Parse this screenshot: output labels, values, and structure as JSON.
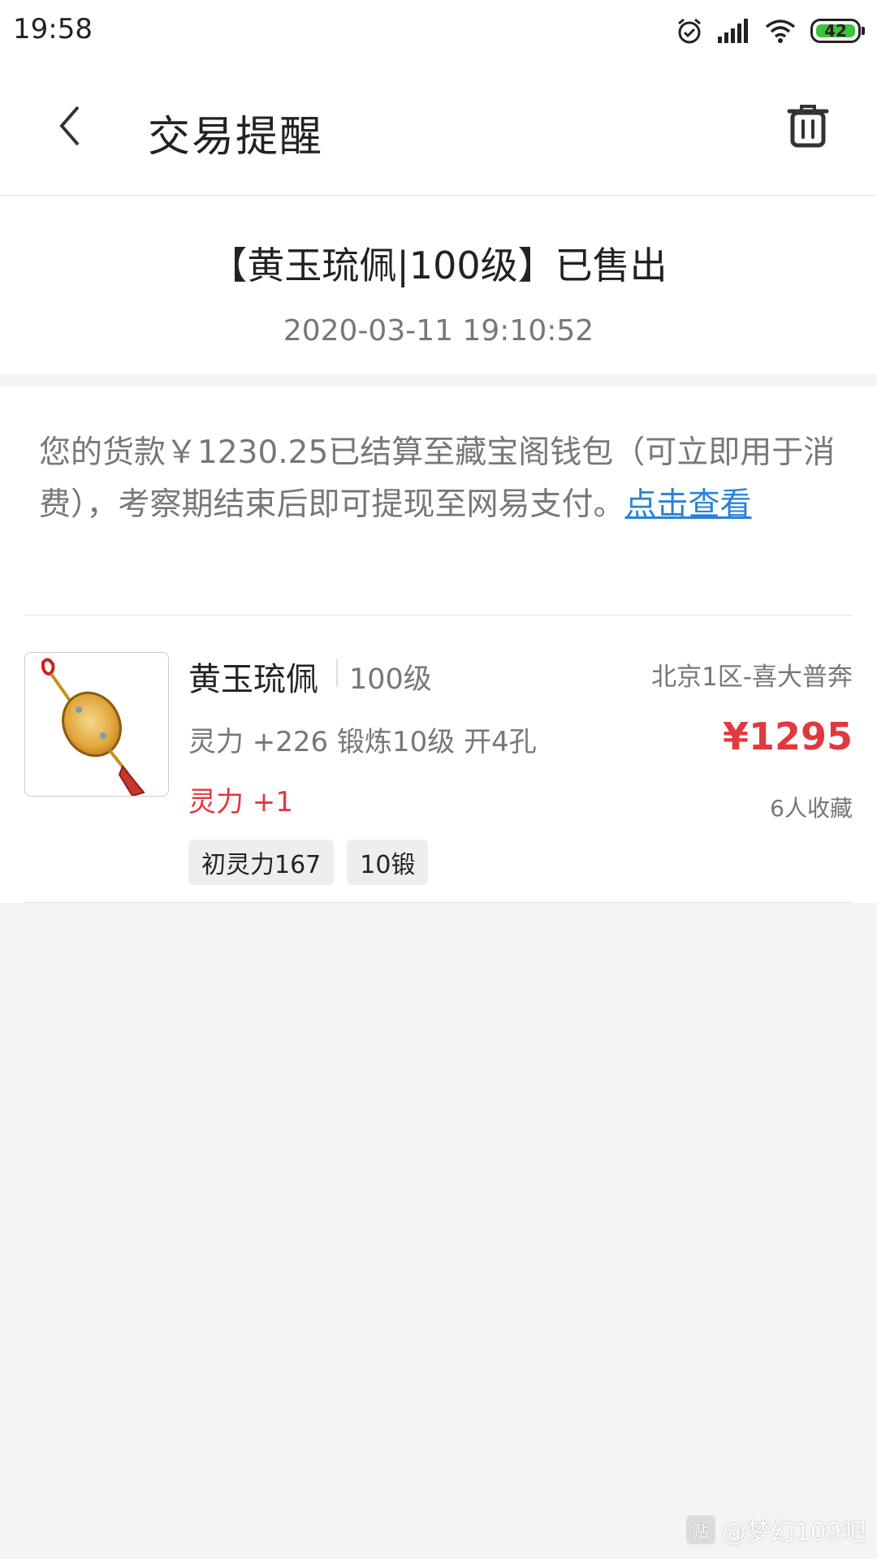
{
  "status_bar": {
    "time": "19:58",
    "battery_level": "42",
    "icons": [
      "alarm-icon",
      "signal-icon",
      "wifi-icon",
      "battery-icon"
    ],
    "battery_color": "#3cc43c"
  },
  "header": {
    "title": "交易提醒",
    "back_icon": "chevron-left-icon",
    "trash_icon": "trash-icon"
  },
  "summary": {
    "title": "【黄玉琉佩|100级】已售出",
    "time": "2020-03-11 19:10:52"
  },
  "notice": {
    "text": "您的货款￥1230.25已结算至藏宝阁钱包（可立即用于消费），考察期结束后即可提现至网易支付。",
    "link": "点击查看"
  },
  "item": {
    "name": "黄玉琉佩",
    "level": "100级",
    "server": "北京1区-喜大普奔",
    "stats": "灵力 +226 锻炼10级 开4孔",
    "price": "¥1295",
    "bonus": "灵力 +1",
    "favorites": "6人收藏",
    "tags": [
      "初灵力167",
      "10锻"
    ],
    "image_icon": "jade-pendant-icon"
  },
  "watermark": {
    "text": "@梦幻109吧"
  },
  "colors": {
    "accent_link": "#2a82d8",
    "price_red": "#e0393e"
  }
}
